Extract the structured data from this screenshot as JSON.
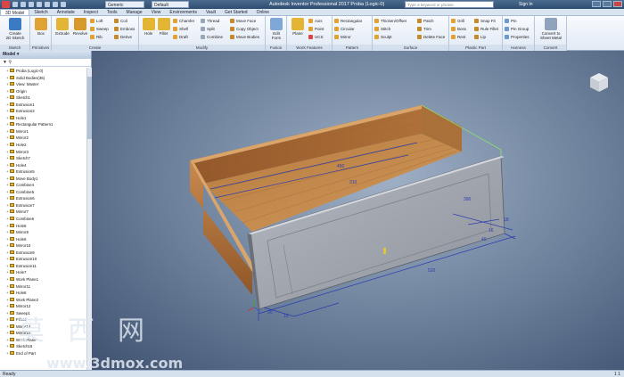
{
  "titlebar": {
    "document_dropdown": "Generic",
    "material_dropdown": "Default",
    "title": "Autodesk Inventor Professional 2017   Proba (Logic-0)",
    "search_placeholder": "Type a keyword or phrase",
    "sign_in": "Sign In"
  },
  "tabs": [
    "3D Model",
    "Sketch",
    "Annotate",
    "Inspect",
    "Tools",
    "Manage",
    "View",
    "Environments",
    "Vault",
    "Get Started",
    "Online"
  ],
  "ribbon": {
    "sketch": {
      "label": "Sketch",
      "create_2d_line1": "Create",
      "create_2d_line2": "2D Sketch"
    },
    "primitives": {
      "label": "Primitives",
      "box": "Box"
    },
    "create": {
      "label": "Create",
      "extrude": "Extrude",
      "revolve": "Revolve",
      "loft": "Loft",
      "sweep": "Sweep",
      "rib": "Rib",
      "coil": "Coil",
      "emboss": "Emboss",
      "derive": "Derive"
    },
    "modify": {
      "label": "Modify",
      "hole": "Hole",
      "fillet": "Fillet",
      "chamfer": "Chamfer",
      "shell": "Shell",
      "draft": "Draft",
      "thread": "Thread",
      "split": "Split",
      "combine": "Combine",
      "move_face": "Move Face",
      "copy_object": "Copy Object",
      "move_bodies": "Move Bodies"
    },
    "fusion": {
      "label": "Fusion",
      "edit_form_line1": "Edit",
      "edit_form_line2": "Form"
    },
    "work_features": {
      "label": "Work Features",
      "plane": "Plane",
      "axis": "Axis",
      "point": "Point",
      "ucs": "UCS"
    },
    "pattern": {
      "label": "Pattern",
      "rectangular": "Rectangular",
      "circular": "Circular",
      "mirror": "Mirror"
    },
    "surface": {
      "label": "Surface",
      "thicken_offset": "Thicken/Offset",
      "stitch": "Stitch",
      "sculpt": "Sculpt",
      "patch": "Patch",
      "trim": "Trim",
      "delete_face": "Delete Face"
    },
    "plastic_part": {
      "label": "Plastic Part",
      "grill": "Grill",
      "boss": "Boss",
      "rest": "Rest",
      "snap_fit": "Snap Fit",
      "rule_fillet": "Rule Fillet",
      "lip": "Lip"
    },
    "harness": {
      "label": "Harness",
      "pin": "Pin",
      "pin_group": "Pin Group",
      "properties": "Properties"
    },
    "convert": {
      "label": "Convert",
      "sheet_metal_line1": "Convert to",
      "sheet_metal_line2": "Sheet Metal"
    }
  },
  "browser": {
    "header": "Model ▾",
    "tools": "▼  ⚲",
    "nodes": [
      "Proba (Logic-0)",
      "Solid Bodies(36)",
      "View: Master",
      "Origin",
      "Sketch1",
      "Extrusion1",
      "Extrusion2",
      "Hole1",
      "Rectangular Pattern1",
      "Mirror1",
      "Mirror2",
      "Hole2",
      "Mirror3",
      "Sketch7",
      "Hole4",
      "Extrusion5",
      "Move Body1",
      "Combine4",
      "Combine5",
      "Extrusion6",
      "Extrusion7",
      "Mirror7",
      "Combine6",
      "Hole5",
      "Mirror8",
      "Hole6",
      "Mirror10",
      "Extrusion9",
      "Extrusion10",
      "Extrusion11",
      "Hole7",
      "Work Plane1",
      "Mirror11",
      "Hole8",
      "Work Plane2",
      "Mirror12",
      "Sweep1",
      "Fillet1",
      "Mirror14",
      "Mirror15",
      "Work Plane",
      "Sketch16",
      "End of Part"
    ]
  },
  "dimensions": [
    "450",
    "310",
    "520",
    "390",
    "40",
    "18",
    "16",
    "20",
    "16"
  ],
  "status": {
    "left": "Ready",
    "right": "1  1"
  },
  "watermark": {
    "chars": "莫西网",
    "url": "www.3dmox.com"
  },
  "colors": {
    "wood_light": "#c98a4e",
    "wood_dark": "#8f5628",
    "front_panel": "#a4a9b2",
    "dimension": "#2b3cb0",
    "viewport_bg": "#7a8ca6"
  }
}
